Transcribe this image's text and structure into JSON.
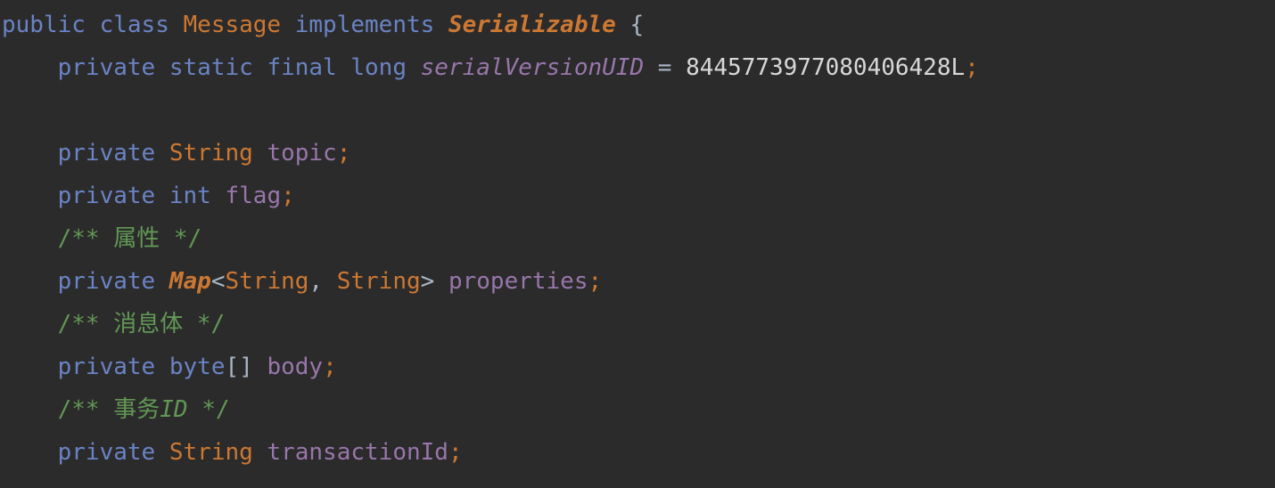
{
  "editor": {
    "background": "#2b2b2b",
    "language": "Java",
    "palette": {
      "keyword": "#6a83c4",
      "class_name": "#cc7832",
      "interface_name": "#cc7832",
      "field": "#9876aa",
      "static_field": "#9876aa",
      "number": "#d8d8d8",
      "comment": "#629755",
      "punctuation": "#a9b7c6",
      "semicolon": "#cc7832"
    }
  },
  "code": {
    "lines": [
      {
        "indent": 0,
        "tokens": [
          {
            "text": "public",
            "style": "keyword"
          },
          {
            "text": " ",
            "style": "plain"
          },
          {
            "text": "class",
            "style": "keyword"
          },
          {
            "text": " ",
            "style": "plain"
          },
          {
            "text": "Message",
            "style": "class"
          },
          {
            "text": " ",
            "style": "plain"
          },
          {
            "text": "implements",
            "style": "keyword"
          },
          {
            "text": " ",
            "style": "plain"
          },
          {
            "text": "Serializable",
            "style": "interface"
          },
          {
            "text": " ",
            "style": "plain"
          },
          {
            "text": "{",
            "style": "punct"
          }
        ]
      },
      {
        "indent": 1,
        "tokens": [
          {
            "text": "private",
            "style": "keyword"
          },
          {
            "text": " ",
            "style": "plain"
          },
          {
            "text": "static",
            "style": "keyword"
          },
          {
            "text": " ",
            "style": "plain"
          },
          {
            "text": "final",
            "style": "keyword"
          },
          {
            "text": " ",
            "style": "plain"
          },
          {
            "text": "long",
            "style": "keyword"
          },
          {
            "text": " ",
            "style": "plain"
          },
          {
            "text": "serialVersionUID",
            "style": "static"
          },
          {
            "text": " ",
            "style": "plain"
          },
          {
            "text": "=",
            "style": "punct"
          },
          {
            "text": " ",
            "style": "plain"
          },
          {
            "text": "8445773977080406428L",
            "style": "number"
          },
          {
            "text": ";",
            "style": "semi"
          }
        ]
      },
      {
        "indent": 0,
        "tokens": []
      },
      {
        "indent": 1,
        "tokens": [
          {
            "text": "private",
            "style": "keyword"
          },
          {
            "text": " ",
            "style": "plain"
          },
          {
            "text": "String",
            "style": "class"
          },
          {
            "text": " ",
            "style": "plain"
          },
          {
            "text": "topic",
            "style": "field"
          },
          {
            "text": ";",
            "style": "semi"
          }
        ]
      },
      {
        "indent": 1,
        "tokens": [
          {
            "text": "private",
            "style": "keyword"
          },
          {
            "text": " ",
            "style": "plain"
          },
          {
            "text": "int",
            "style": "keyword"
          },
          {
            "text": " ",
            "style": "plain"
          },
          {
            "text": "flag",
            "style": "field"
          },
          {
            "text": ";",
            "style": "semi"
          }
        ]
      },
      {
        "indent": 1,
        "tokens": [
          {
            "text": "/** 属性 */",
            "style": "comment"
          }
        ]
      },
      {
        "indent": 1,
        "tokens": [
          {
            "text": "private",
            "style": "keyword"
          },
          {
            "text": " ",
            "style": "plain"
          },
          {
            "text": "Map",
            "style": "interface"
          },
          {
            "text": "<",
            "style": "punct"
          },
          {
            "text": "String",
            "style": "class"
          },
          {
            "text": ", ",
            "style": "punct"
          },
          {
            "text": "String",
            "style": "class"
          },
          {
            "text": ">",
            "style": "punct"
          },
          {
            "text": " ",
            "style": "plain"
          },
          {
            "text": "properties",
            "style": "field"
          },
          {
            "text": ";",
            "style": "semi"
          }
        ]
      },
      {
        "indent": 1,
        "tokens": [
          {
            "text": "/** 消息体 */",
            "style": "comment"
          }
        ]
      },
      {
        "indent": 1,
        "tokens": [
          {
            "text": "private",
            "style": "keyword"
          },
          {
            "text": " ",
            "style": "plain"
          },
          {
            "text": "byte",
            "style": "keyword"
          },
          {
            "text": "[]",
            "style": "punct"
          },
          {
            "text": " ",
            "style": "plain"
          },
          {
            "text": "body",
            "style": "field"
          },
          {
            "text": ";",
            "style": "semi"
          }
        ]
      },
      {
        "indent": 1,
        "tokens": [
          {
            "text": "/** 事务",
            "style": "comment"
          },
          {
            "text": "ID",
            "style": "comment-em"
          },
          {
            "text": " */",
            "style": "comment"
          }
        ]
      },
      {
        "indent": 1,
        "tokens": [
          {
            "text": "private",
            "style": "keyword"
          },
          {
            "text": " ",
            "style": "plain"
          },
          {
            "text": "String",
            "style": "class"
          },
          {
            "text": " ",
            "style": "plain"
          },
          {
            "text": "transactionId",
            "style": "field"
          },
          {
            "text": ";",
            "style": "semi"
          }
        ]
      }
    ]
  }
}
